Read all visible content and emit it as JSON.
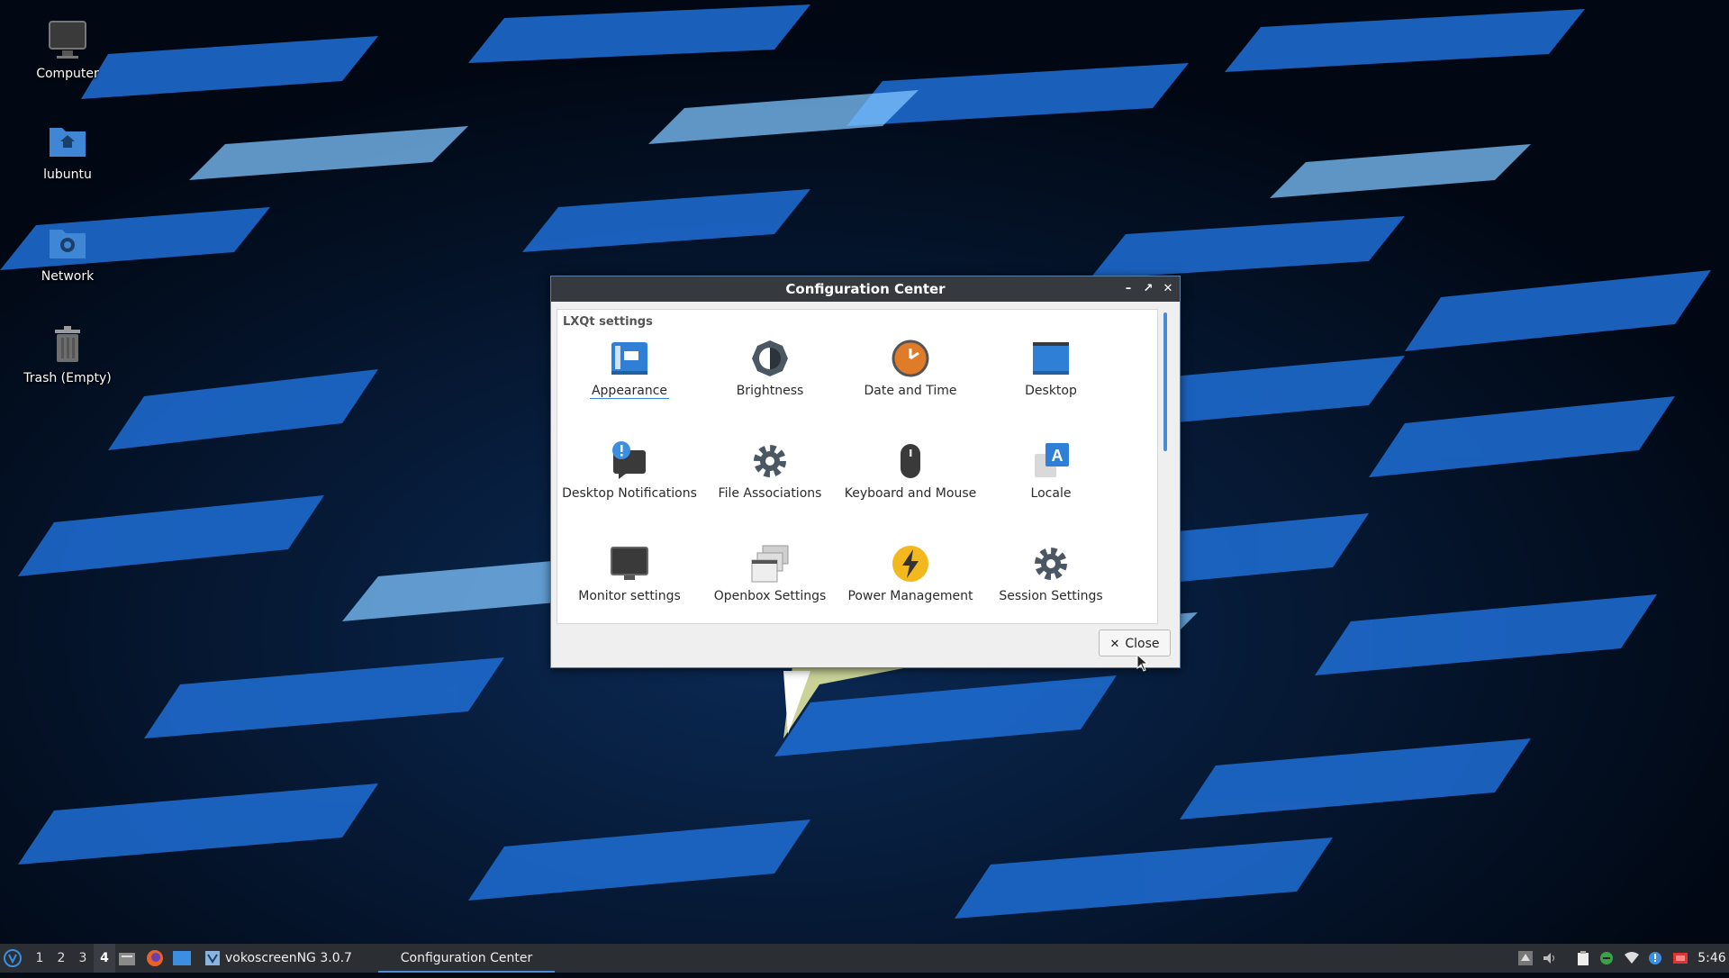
{
  "desktop": {
    "icons": [
      {
        "label": "Computer",
        "icon": "computer-icon"
      },
      {
        "label": "lubuntu",
        "icon": "home-folder-icon"
      },
      {
        "label": "Network",
        "icon": "network-folder-icon"
      },
      {
        "label": "Trash (Empty)",
        "icon": "trash-icon"
      }
    ]
  },
  "window": {
    "title": "Configuration Center",
    "section": "LXQt settings",
    "items": [
      {
        "label": "Appearance",
        "icon": "appearance-icon",
        "selected": true
      },
      {
        "label": "Brightness",
        "icon": "brightness-icon"
      },
      {
        "label": "Date and Time",
        "icon": "clock-icon"
      },
      {
        "label": "Desktop",
        "icon": "desktop-icon"
      },
      {
        "label": "Desktop Notifications",
        "icon": "notifications-icon"
      },
      {
        "label": "File Associations",
        "icon": "gear-icon"
      },
      {
        "label": "Keyboard and Mouse",
        "icon": "mouse-icon"
      },
      {
        "label": "Locale",
        "icon": "locale-icon"
      },
      {
        "label": "Monitor settings",
        "icon": "monitor-icon"
      },
      {
        "label": "Openbox Settings",
        "icon": "openbox-icon"
      },
      {
        "label": "Power Management",
        "icon": "power-icon"
      },
      {
        "label": "Session Settings",
        "icon": "gear-icon"
      }
    ],
    "close_label": "Close"
  },
  "taskbar": {
    "workspaces": [
      "1",
      "2",
      "3",
      "4"
    ],
    "active_workspace": "4",
    "tasks": [
      {
        "label": "vokoscreenNG 3.0.7"
      },
      {
        "label": "Configuration Center"
      }
    ],
    "clock": "5:46"
  },
  "colors": {
    "accent": "#4a8ad6",
    "titlebar": "#36393d",
    "taskbar": "#2b2e33"
  }
}
